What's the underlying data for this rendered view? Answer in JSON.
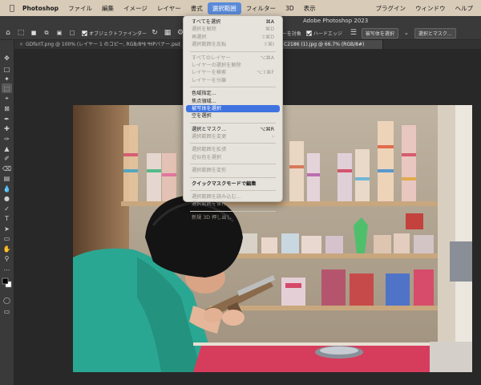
{
  "menubar": {
    "app_name": "Photoshop",
    "items": [
      "ファイル",
      "編集",
      "イメージ",
      "レイヤー",
      "書式",
      "選択範囲",
      "フィルター",
      "3D",
      "表示"
    ],
    "right_items": [
      "プラグイン",
      "ウィンドウ",
      "ヘルプ"
    ],
    "active_item": "選択範囲"
  },
  "window": {
    "title": "Adobe Photoshop 2023"
  },
  "options_bar": {
    "object_finder_label": "オブジェクトファインダー",
    "sample_all_layers_label": "全レイヤーを対象",
    "hard_edge_label": "ハードエッジ",
    "select_subject_label": "被写体を選択",
    "select_and_mask_label": "選択とマスク..."
  },
  "tabs": [
    {
      "label": "GDfsrIT.png @ 100% (レイヤー 1 のコピー, RGB/8*) *"
    },
    {
      "label": "HPバナー.psd"
    },
    {
      "label": "C2186 (1).jpg @ 66.7% (RGB/8#)"
    }
  ],
  "select_menu": {
    "groups": [
      [
        {
          "label": "すべてを選択",
          "shortcut": "⌘A",
          "disabled": false
        },
        {
          "label": "選択を解除",
          "shortcut": "⌘D",
          "disabled": true
        },
        {
          "label": "再選択",
          "shortcut": "⇧⌘D",
          "disabled": true
        },
        {
          "label": "選択範囲を反転",
          "shortcut": "⇧⌘I",
          "disabled": true
        }
      ],
      [
        {
          "label": "すべてのレイヤー",
          "shortcut": "⌥⌘A",
          "disabled": true
        },
        {
          "label": "レイヤーの選択を解除",
          "shortcut": "",
          "disabled": true
        },
        {
          "label": "レイヤーを検索",
          "shortcut": "⌥⇧⌘F",
          "disabled": true
        },
        {
          "label": "レイヤーを分離",
          "shortcut": "",
          "disabled": true
        }
      ],
      [
        {
          "label": "色域指定...",
          "shortcut": "",
          "disabled": false
        },
        {
          "label": "焦点領域...",
          "shortcut": "",
          "disabled": false
        },
        {
          "label": "被写体を選択",
          "shortcut": "",
          "disabled": false,
          "highlighted": true
        },
        {
          "label": "空を選択",
          "shortcut": "",
          "disabled": false
        }
      ],
      [
        {
          "label": "選択とマスク...",
          "shortcut": "⌥⌘R",
          "disabled": false
        },
        {
          "label": "選択範囲を変更",
          "shortcut": "›",
          "disabled": true
        }
      ],
      [
        {
          "label": "選択範囲を拡張",
          "shortcut": "",
          "disabled": true
        },
        {
          "label": "近似色を選択",
          "shortcut": "",
          "disabled": true
        }
      ],
      [
        {
          "label": "選択範囲を変形",
          "shortcut": "",
          "disabled": true
        }
      ],
      [
        {
          "label": "クイックマスクモードで編集",
          "shortcut": "",
          "disabled": false,
          "bold": true
        }
      ],
      [
        {
          "label": "選択範囲を読み込む...",
          "shortcut": "",
          "disabled": true
        },
        {
          "label": "選択範囲を保存...",
          "shortcut": "",
          "disabled": true
        }
      ],
      [
        {
          "label": "新規 3D 押し出し",
          "shortcut": "",
          "disabled": true
        }
      ]
    ]
  },
  "colors": {
    "menubar_bg": "#d8cbb8",
    "highlight": "#3f74e0",
    "panel_bg": "#3a3a3a",
    "canvas_bg": "#282828"
  }
}
